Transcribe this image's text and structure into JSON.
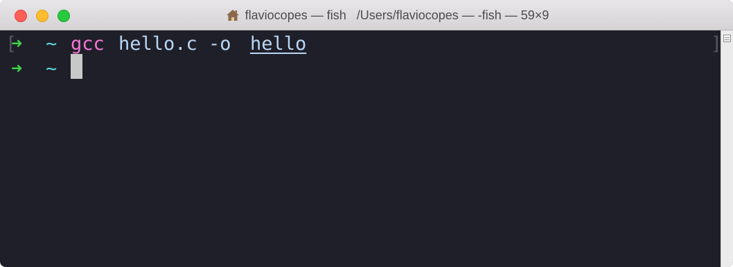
{
  "window": {
    "title": "flaviocopes — fish   /Users/flaviocopes — -fish — 59×9",
    "icon": "home-icon"
  },
  "terminal": {
    "lines": [
      {
        "prompt_arrow": "➜",
        "prompt_dir": "~",
        "command": "gcc",
        "args_plain": "hello.c -o",
        "args_underlined": "hello"
      },
      {
        "prompt_arrow": "➜",
        "prompt_dir": "~"
      }
    ],
    "bracket_left": "[",
    "bracket_right": "]"
  },
  "colors": {
    "background": "#1f1f29",
    "arrow": "#40d04a",
    "tilde": "#5bd6e0",
    "command": "#f477d5",
    "args": "#b9d7f5",
    "cursor": "#c8c8c8"
  }
}
